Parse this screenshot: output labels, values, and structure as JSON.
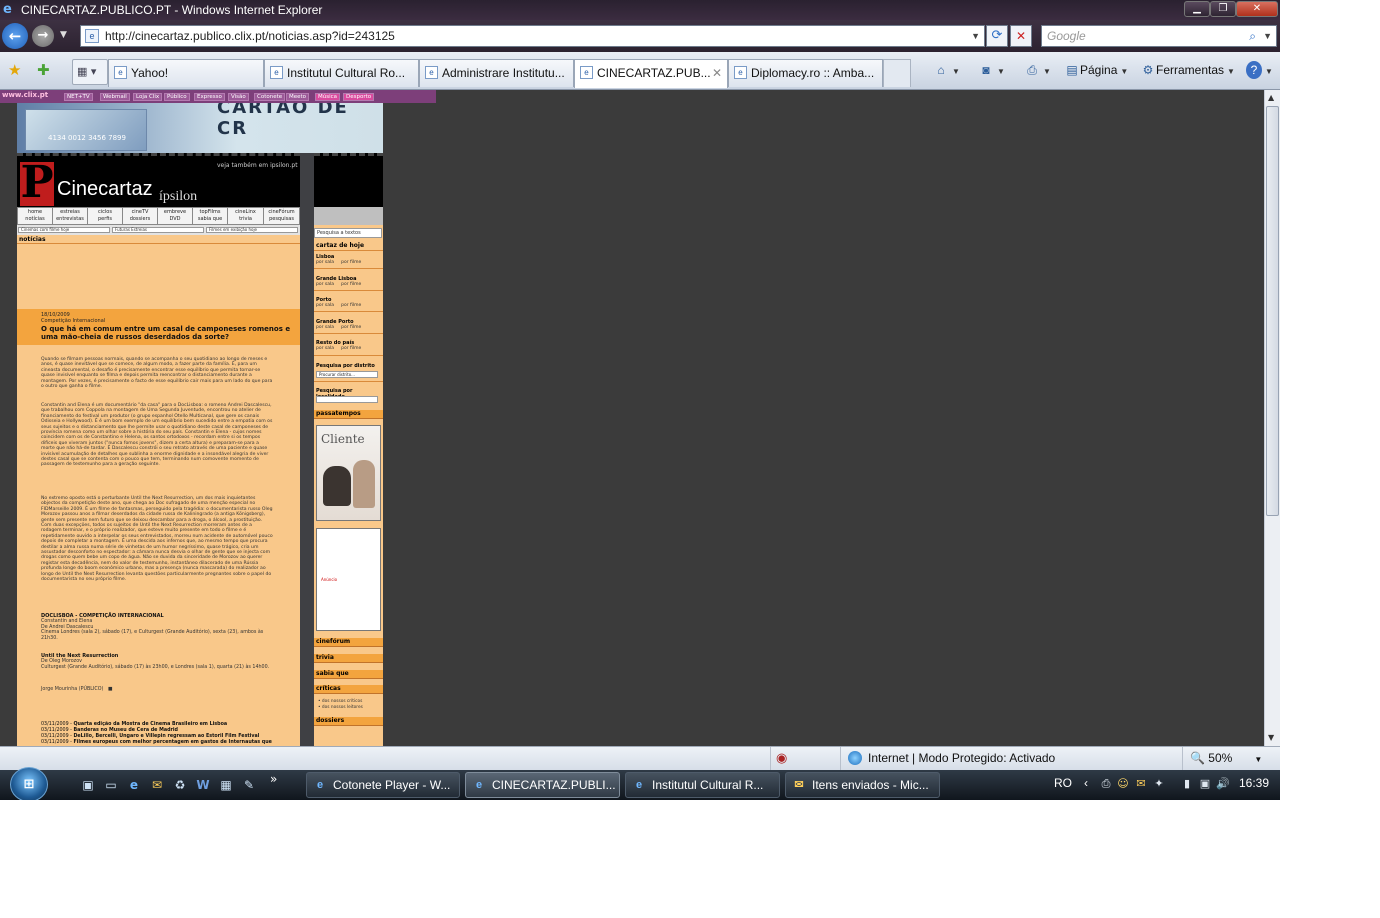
{
  "window": {
    "title": "CINECARTAZ.PUBLICO.PT - Windows Internet Explorer",
    "controls": {
      "minimize": "▁",
      "maximize": "❐",
      "close": "✕"
    }
  },
  "navigation": {
    "back_glyph": "←",
    "forward_glyph": "→",
    "url": "http://cinecartaz.publico.clix.pt/noticias.asp?id=243125",
    "search_placeholder": "Google"
  },
  "tabs": [
    {
      "label": "Yahoo!",
      "active": false
    },
    {
      "label": "Institutul Cultural Ro...",
      "active": false
    },
    {
      "label": "Administrare Institutu...",
      "active": false
    },
    {
      "label": "CINECARTAZ.PUB...",
      "active": true
    },
    {
      "label": "Diplomacy.ro :: Amba...",
      "active": false
    }
  ],
  "command_bar": {
    "page": "Página",
    "tools": "Ferramentas"
  },
  "clix_bar": {
    "logo": "www.clix.pt",
    "items": [
      "NET+TV",
      "Webmail",
      "Loja Clix",
      "Público",
      "Expresso",
      "Visão",
      "Cotonete",
      "Meeto",
      "Música",
      "Desporto"
    ]
  },
  "site": {
    "banner_text": "CARTÃO DE CR",
    "banner_card": "4134 0012 3456 7899",
    "see_also": "veja também em ipsilon.pt",
    "brand": "Cinecartaz",
    "brand_sub": "ípsilon",
    "menu": [
      [
        "home",
        "notícias"
      ],
      [
        "estreias",
        "entrevistas"
      ],
      [
        "ciclos",
        "perfis"
      ],
      [
        "cineTV",
        "dossiers"
      ],
      [
        "embreve",
        "DVD"
      ],
      [
        "topFilms",
        "sabia que"
      ],
      [
        "cineLinx",
        "trivia"
      ],
      [
        "cineFórum",
        "pesquisas"
      ]
    ],
    "sub_search": [
      "Cinemas com filme hoje",
      "Futuras Estreias",
      "Filmes em exibição hoje"
    ],
    "right_search": "Pesquisa a textos"
  },
  "article": {
    "section": "notícias",
    "date": "18/10/2009",
    "category": "Competição Internacional",
    "title": "O que há em comum entre um casal de camponeses romenos e uma mão-cheia de russos deserdados da sorte?",
    "paragraphs": [
      "Quando se filmam pessoas normais, quando se acompanha o seu quotidiano ao longo de meses e anos, é quase inevitável que se comece, de algum modo, a fazer parte da família. É, para um cineasta documental, o desafio é precisamente encontrar esse equilíbrio que permita tornar-se quase invisível enquanto se filma e depois permita reencontrar o distanciamento durante a montagem. Por vezes, é precisamente o facto de esse equilíbrio cair mais para um lado do que para o outro que ganha o filme.",
      "Constantin and Elena é um documentário \"da casa\" para o DocLisboa: o romeno Andrei Dascalescu, que trabalhou com Coppola na montagem de Uma Segunda Juventude, encontrou no atelier de financiamento do festival um produtor (o grupo espanhol Otello Multicanal, que gere os canais Odisseia e Hollywood). É é um bom exemplo de um equilíbrio bem sucedido entre a empatia com os seus sujeitos e o distanciamento que lhe permite usar o quotidiano deste casal de camponeses de província romena como um olhar sobre a história do seu país. Constantin e Elena - cujos nomes coincidem com os de Constantino e Helena, os santos ortodoxos - recordam entre si os tempos difíceis que viveram juntos (\"nunca fomos jovens\", dizem a certa altura) e preparam-se para a morte que não há-de tardar. É Dascalescu constrói o seu retrato através de uma paciente e quase invisível acumulação de detalhes que sublinha a enorme dignidade e a insondável alegria de viver destes casal que se contenta com o pouco que tem, terminando num comovente momento de passagem de testemunho para a geração seguinte.",
      "No extremo oposto está o perturbante Until the Next Resurrection, um dos mais inquietantes objectos da competição deste ano, que chega ao Doc sufragado de uma menção especial no FIDMarseille 2009. É um filme de fantasmas, perseguido pela tragédia: o documentarista russo Oleg Morozov passou anos a filmar deserdados da cidade russa de Kaliningrado (a antiga Königsberg), gente sem presente nem futuro que se deixou descambar para a droga, o álcool, a prostituição. Com duas excepções, todos os sujeitos de Until the Next Resurrection morreram antes de a rodagem terminar, e o próprio realizador, que esteve muito presente em todo o filme e é repetidamente ouvido a interpelar os seus entrevistados, morreu num acidente de automóvel pouco depois de completar a montagem. É uma descida aos infernos que, ao mesmo tempo que procura destilar a alma russa numa série de vinhetas de um humor negríssimo, quase trágico, cria um assustador desconforto no espectador: a câmara nunca desvia o olhar de gente que se injecta com drogas como quem bebe um copo de água. Não se duvida da sinceridade de Morozov ao querer registar esta decadência, nem do valor de testemunho, instantâneo dilacerado de uma Rússia profunda longe do boom económico urbano, mas a presença (nunca mascarada) do realizador ao longo de Until the Next Resurrection levanta questões particularmente pregnantes sobre o papel do documentarista no seu próprio filme."
    ],
    "info_title": "DOCLISBOA - COMPETIÇÃO INTERNACIONAL",
    "info_lines": [
      "Constantin and Elena",
      "De Andrei Dascalescu",
      "Cinema Londres (sala 2), sábado (17), e Culturgest (Grande Auditório), sexta (23), ambos às 21h30."
    ],
    "info2_title": "Until the Next Resurrection",
    "info2_lines": [
      "De Oleg Morozov",
      "Culturgest (Grande Auditório), sábado (17) às 23h00, e Londres (sala 1), quarta (21) às 14h00."
    ],
    "author": "Jorge Mourinha (PÚBLICO)",
    "related": [
      {
        "date": "03/11/2009 - ",
        "title": "Quarta edição da Mostra de Cinema Brasileiro em Lisboa"
      },
      {
        "date": "03/11/2009 - ",
        "title": "Banderas no Museu de Cera de Madrid"
      },
      {
        "date": "03/11/2009 - ",
        "title": "DeLillo, Bercelli, Ungaro e Villepin regressam ao Estoril Film Festival"
      },
      {
        "date": "03/11/2009 - ",
        "title": "Filmes europeus com melhor percentagem em gastos de Internautas que"
      }
    ]
  },
  "sidebar": {
    "cartaz": "cartaz de hoje",
    "cities": [
      "Lisboa",
      "Grande Lisboa",
      "Porto",
      "Grande Porto",
      "Resto do país"
    ],
    "by_room": "por sala",
    "by_film": "por filme",
    "district_title": "Pesquisa por distrito",
    "district_placeholder": "Procurar distrito...",
    "locality_title": "Pesquisa por localidade",
    "passatempos": "passatempos",
    "poster_title": "Cliente",
    "ad_text": "Anúncio",
    "links": [
      "cinefórum",
      "trivia",
      "sabia que",
      "críticas",
      "dossiers"
    ],
    "criticas_items": [
      "• dos nossos críticos",
      "• dos nossos leitores"
    ]
  },
  "statusbar": {
    "zone": "Internet | Modo Protegido: Activado",
    "zoom": "50%"
  },
  "taskbar": {
    "start_glyph": "⊞",
    "tasks": [
      {
        "label": "Cotonete Player - W...",
        "active": false
      },
      {
        "label": "CINECARTAZ.PUBLI...",
        "active": true
      },
      {
        "label": "Institutul Cultural R...",
        "active": false
      },
      {
        "label": "Itens enviados - Mic...",
        "active": false
      }
    ],
    "language": "RO",
    "clock": "16:39"
  }
}
